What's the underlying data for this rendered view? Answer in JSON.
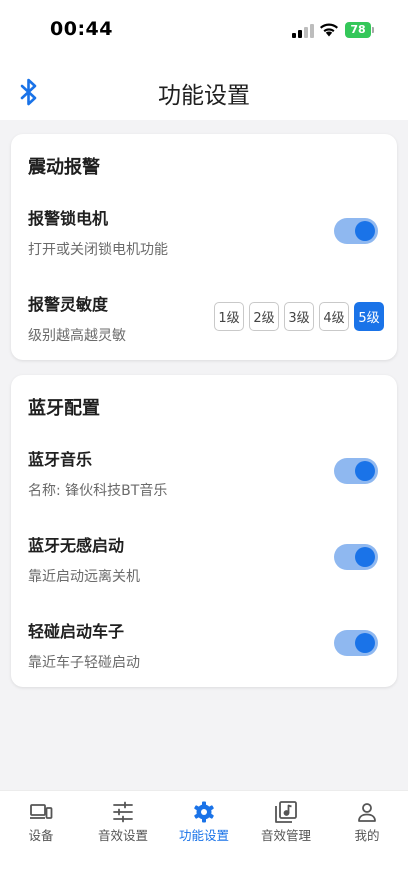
{
  "status_bar": {
    "time": "00:44",
    "battery": "78"
  },
  "header": {
    "title": "功能设置",
    "left_icon": "bluetooth-icon"
  },
  "vibration_card": {
    "title": "震动报警",
    "lock_motor": {
      "title": "报警锁电机",
      "subtitle": "打开或关闭锁电机功能",
      "enabled": true
    },
    "sensitivity": {
      "title": "报警灵敏度",
      "subtitle": "级别越高越灵敏",
      "levels": [
        "1级",
        "2级",
        "3级",
        "4级",
        "5级"
      ],
      "selected": "5级"
    }
  },
  "bluetooth_card": {
    "title": "蓝牙配置",
    "music": {
      "title": "蓝牙音乐",
      "subtitle": "名称: 锋伙科技BT音乐",
      "enabled": true
    },
    "auto_start": {
      "title": "蓝牙无感启动",
      "subtitle": "靠近启动远离关机",
      "enabled": true
    },
    "touch_start": {
      "title": "轻碰启动车子",
      "subtitle": "靠近车子轻碰启动",
      "enabled": true
    }
  },
  "tab_bar": {
    "active": "功能设置",
    "items": [
      {
        "label": "设备",
        "icon": "devices-icon"
      },
      {
        "label": "音效设置",
        "icon": "sliders-icon"
      },
      {
        "label": "功能设置",
        "icon": "gear-icon"
      },
      {
        "label": "音效管理",
        "icon": "music-library-icon"
      },
      {
        "label": "我的",
        "icon": "person-icon"
      }
    ]
  },
  "colors": {
    "accent": "#1a73e8",
    "toggle_track": "#8fb8f0",
    "battery": "#34c759",
    "background": "#f3f3f5"
  }
}
